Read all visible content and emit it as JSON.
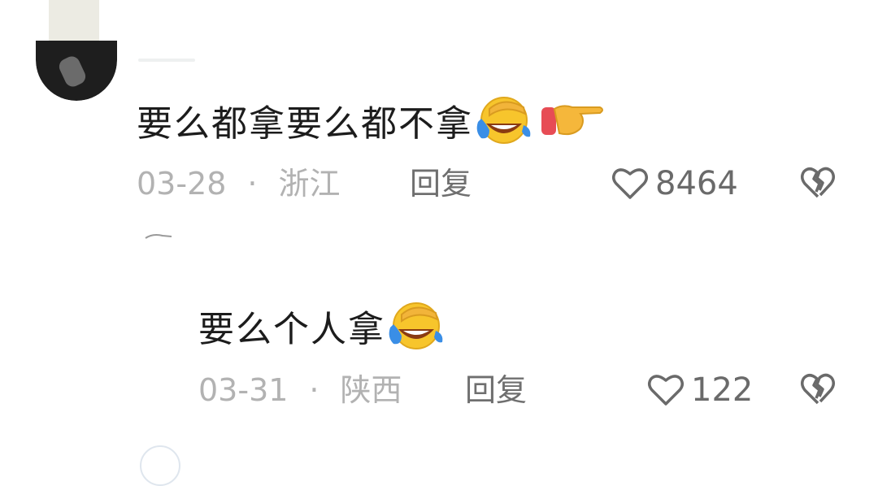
{
  "comments": [
    {
      "text": "要么都拿要么都不拿",
      "emojis": [
        "facepalm-laugh-emoji",
        "pointing-right-emoji"
      ],
      "date": "03-28",
      "separator": "·",
      "location": "浙江",
      "reply_label": "回复",
      "likes": "8464"
    },
    {
      "text": "要么个人拿",
      "emojis": [
        "facepalm-laugh-emoji"
      ],
      "date": "03-31",
      "separator": "·",
      "location": "陕西",
      "reply_label": "回复",
      "likes": "122"
    }
  ],
  "colors": {
    "text": "#1c1c1c",
    "meta": "#b2b2b2",
    "reply": "#6f6f6f",
    "icon": "#6a6a6a",
    "emoji_face": "#f7c52c",
    "emoji_tear": "#3a8ee6",
    "hand": "#f5b73b",
    "cuff": "#e74c55"
  }
}
